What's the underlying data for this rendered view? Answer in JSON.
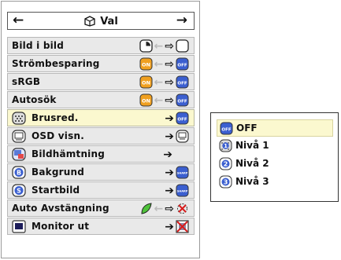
{
  "header": {
    "title": "Val",
    "left_arrow": "←",
    "right_arrow": "→"
  },
  "menu": {
    "items": [
      {
        "label": "Bild i bild",
        "selected": false,
        "icon": null,
        "from_icon": "half-circle-square-icon",
        "to_icon": "blank-square-icon"
      },
      {
        "label": "Strömbesparing",
        "selected": false,
        "icon": null,
        "from_icon": "on-badge-icon",
        "to_icon": "off-badge-icon",
        "from_text": "ON",
        "to_text": "OFF"
      },
      {
        "label": "sRGB",
        "selected": false,
        "icon": null,
        "from_icon": "on-badge-icon",
        "to_icon": "off-badge-icon",
        "from_text": "ON",
        "to_text": "OFF"
      },
      {
        "label": "Autosök",
        "selected": false,
        "icon": null,
        "from_icon": "on-badge-icon",
        "to_icon": "off-badge-icon",
        "from_text": "ON",
        "to_text": "OFF"
      },
      {
        "label": "Brusred.",
        "selected": true,
        "icon": "noise-reduction-icon",
        "to_icon": "off-badge-icon",
        "to_text": "OFF"
      },
      {
        "label": "OSD visn.",
        "selected": false,
        "icon": "osd-display-icon",
        "to_icon": "osd-value-icon"
      },
      {
        "label": "Bildhämtning",
        "selected": false,
        "icon": "image-capture-icon",
        "to_icon": null
      },
      {
        "label": "Bakgrund",
        "selected": false,
        "icon": "b-badge-icon",
        "icon_text": "B",
        "to_icon": "sharp-badge-icon",
        "to_text": "SHARP"
      },
      {
        "label": "Startbild",
        "selected": false,
        "icon": "s-badge-icon",
        "icon_text": "S",
        "to_icon": "sharp-badge-icon",
        "to_text": "SHARP"
      },
      {
        "label": "Auto Avstängning",
        "selected": false,
        "icon": null,
        "from_icon": "leaf-icon",
        "to_icon": "timer-cross-icon"
      },
      {
        "label": "Monitor ut",
        "selected": false,
        "icon": "monitor-icon",
        "to_icon": "crossed-box-icon"
      }
    ]
  },
  "popup": {
    "options": [
      {
        "label": "OFF",
        "icon": "off-badge-icon",
        "icon_text": "OFF",
        "selected": true
      },
      {
        "label": "Nivå 1",
        "icon": "level-1-icon",
        "icon_text": "1",
        "selected": false
      },
      {
        "label": "Nivå 2",
        "icon": "level-2-icon",
        "icon_text": "2",
        "selected": false
      },
      {
        "label": "Nivå 3",
        "icon": "level-3-icon",
        "icon_text": "3",
        "selected": false
      }
    ]
  },
  "colors": {
    "orange": "#f0a020",
    "blue": "#3b5fd0",
    "selected_row": "#fbf8cf",
    "row_bg": "#e9e9e9",
    "leaf_green": "#4ec23a",
    "red": "#d81c1c"
  }
}
